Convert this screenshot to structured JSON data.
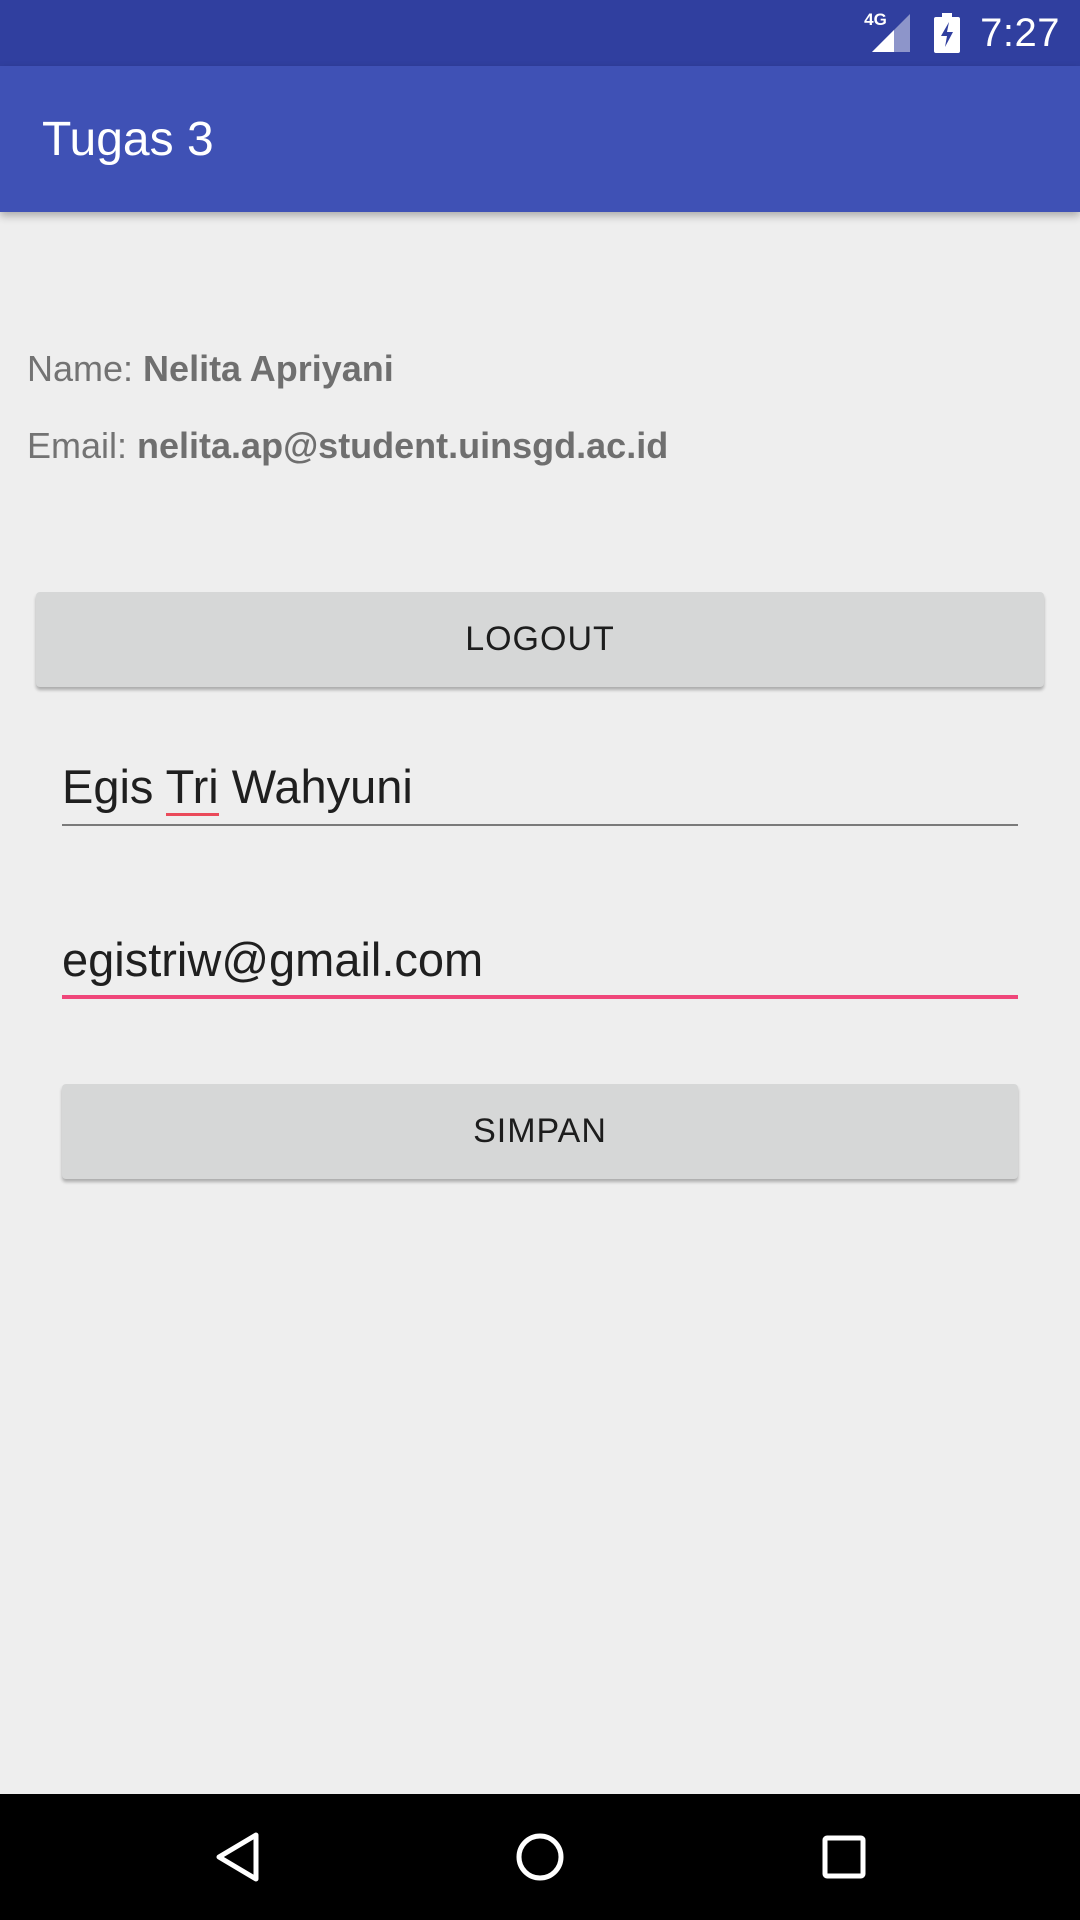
{
  "status_bar": {
    "network_type": "4G",
    "time": "7:27",
    "icons": [
      "signal-icon",
      "battery-charging-icon"
    ]
  },
  "app_bar": {
    "title": "Tugas 3",
    "color": "#3f51b5"
  },
  "profile": {
    "name_label": "Name: ",
    "name_value": "Nelita Apriyani",
    "email_label": "Email: ",
    "email_value": "nelita.ap@student.uinsgd.ac.id"
  },
  "buttons": {
    "logout_label": "LOGOUT",
    "save_label": "SIMPAN"
  },
  "form": {
    "name_value_part1": "Egis ",
    "name_value_misspelled": "Tri",
    "name_value_part2": " Wahyuni",
    "email_value": "egistriw@gmail.com",
    "focus_color": "#ef467a"
  },
  "nav_bar": {
    "icons": [
      "back-icon",
      "home-icon",
      "recent-apps-icon"
    ]
  }
}
